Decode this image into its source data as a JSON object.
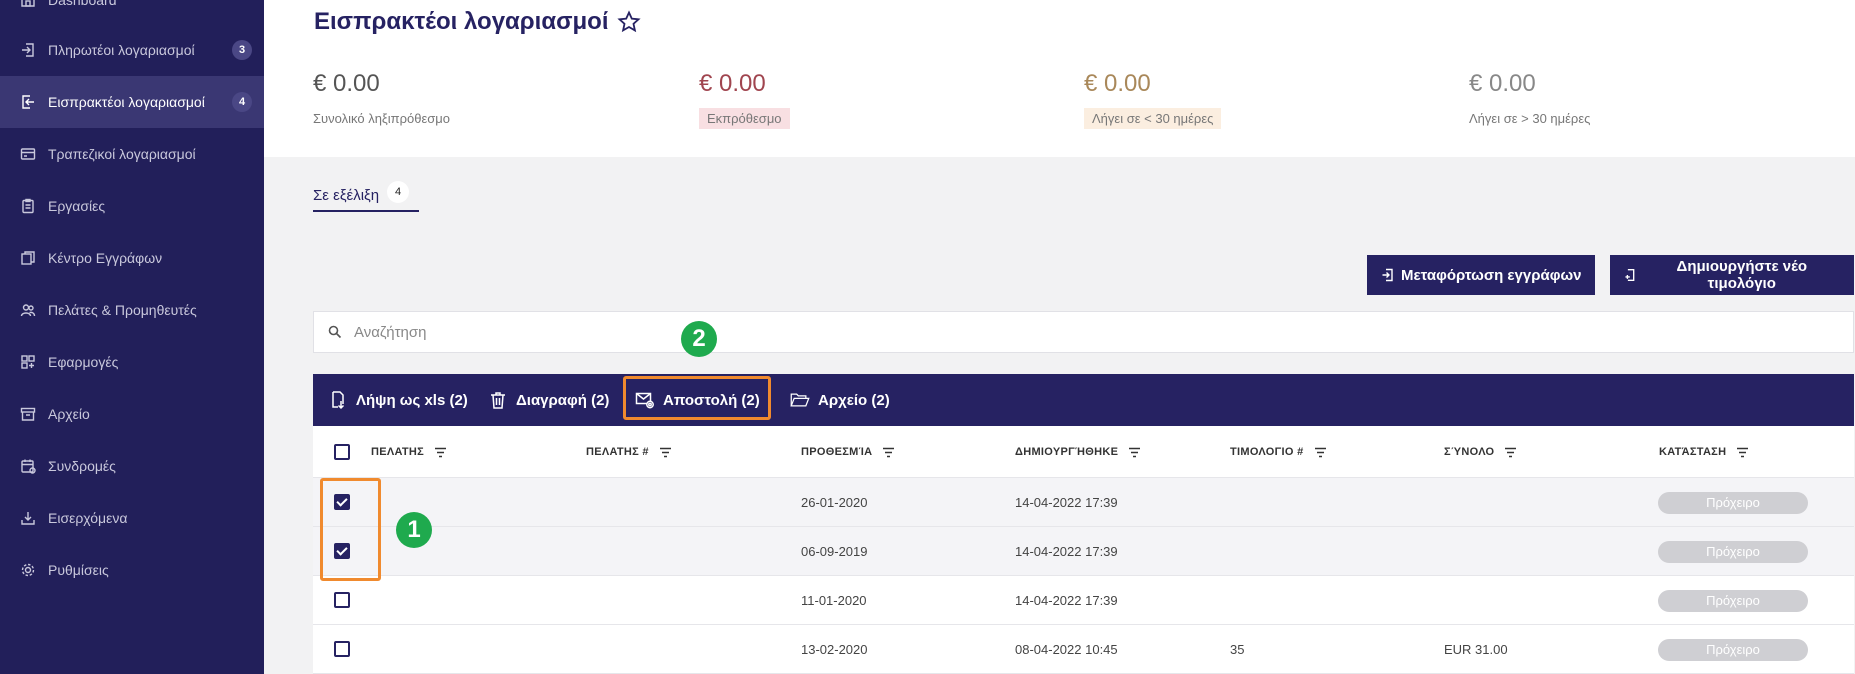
{
  "sidebar": {
    "items": [
      {
        "label": "Dashboard",
        "icon": "home-icon",
        "badge": ""
      },
      {
        "label": "Πληρωτέοι λογαριασμοί",
        "icon": "login-icon",
        "badge": "3"
      },
      {
        "label": "Εισπρακτέοι λογαριασμοί",
        "icon": "logout-icon",
        "badge": "4"
      },
      {
        "label": "Τραπεζικοί λογαριασμοί",
        "icon": "credit-card-icon",
        "badge": ""
      },
      {
        "label": "Εργασίες",
        "icon": "clipboard-icon",
        "badge": ""
      },
      {
        "label": "Κέντρο Εγγράφων",
        "icon": "documents-icon",
        "badge": ""
      },
      {
        "label": "Πελάτες & Προμηθευτές",
        "icon": "users-icon",
        "badge": ""
      },
      {
        "label": "Εφαρμογές",
        "icon": "apps-icon",
        "badge": ""
      },
      {
        "label": "Αρχείο",
        "icon": "archive-icon",
        "badge": ""
      },
      {
        "label": "Συνδρομές",
        "icon": "calendar-icon",
        "badge": ""
      },
      {
        "label": "Εισερχόμενα",
        "icon": "inbox-download-icon",
        "badge": ""
      },
      {
        "label": "Ρυθμίσεις",
        "icon": "gear-icon",
        "badge": ""
      }
    ]
  },
  "header": {
    "title": "Εισπρακτέοι λογαριασμοί"
  },
  "kpis": [
    {
      "amount": "€ 0.00",
      "label": "Συνολικό ληξιπρόθεσμο",
      "color": "#555555",
      "label_bg": ""
    },
    {
      "amount": "€ 0.00",
      "label": "Εκπρόθεσμο",
      "color": "#a0454f",
      "label_bg": "#f8dfe2"
    },
    {
      "amount": "€ 0.00",
      "label": "Λήγει σε < 30 ημέρες",
      "color": "#a9885a",
      "label_bg": "#fbeee0"
    },
    {
      "amount": "€ 0.00",
      "label": "Λήγει σε > 30 ημέρες",
      "color": "#888888",
      "label_bg": ""
    }
  ],
  "tabs": [
    {
      "label": "Σε εξέλιξη",
      "count": "4"
    }
  ],
  "actions": {
    "upload_label": "Μεταφόρτωση εγγράφων",
    "create_label": "Δημιουργήστε νέο τιμολόγιο"
  },
  "search": {
    "placeholder": "Αναζήτηση",
    "value": ""
  },
  "bulk": {
    "xls_label": "Λήψη ως xls (2)",
    "delete_label": "Διαγραφή (2)",
    "send_label": "Αποστολή (2)",
    "archive_label": "Αρχείο (2)"
  },
  "table": {
    "columns": [
      "ΠΕΛΑΤΗΣ",
      "ΠΕΛΑΤΗΣ #",
      "ΠΡΟΘΕΣΜΊΑ",
      "ΔΗΜΙΟΥΡΓΉΘΗΚΕ",
      "ΤΙΜΟΛΟΓΙΟ #",
      "ΣΎΝΟΛΟ",
      "ΚΑΤΆΣΤΑΣΗ"
    ],
    "rows": [
      {
        "checked": true,
        "client": "",
        "client_no": "",
        "due": "26-01-2020",
        "created": "14-04-2022 17:39",
        "invoice_no": "",
        "total": "",
        "status": "Πρόχειρο"
      },
      {
        "checked": true,
        "client": "",
        "client_no": "",
        "due": "06-09-2019",
        "created": "14-04-2022 17:39",
        "invoice_no": "",
        "total": "",
        "status": "Πρόχειρο"
      },
      {
        "checked": false,
        "client": "",
        "client_no": "",
        "due": "11-01-2020",
        "created": "14-04-2022 17:39",
        "invoice_no": "",
        "total": "",
        "status": "Πρόχειρο"
      },
      {
        "checked": false,
        "client": "",
        "client_no": "",
        "due": "13-02-2020",
        "created": "08-04-2022 10:45",
        "invoice_no": "35",
        "total": "EUR 31.00",
        "status": "Πρόχειρο"
      }
    ]
  },
  "annotations": [
    {
      "number": "1",
      "color": "#1faa4e",
      "box_color": "#f08a2e"
    },
    {
      "number": "2",
      "color": "#1faa4e",
      "box_color": "#f08a2e"
    }
  ]
}
